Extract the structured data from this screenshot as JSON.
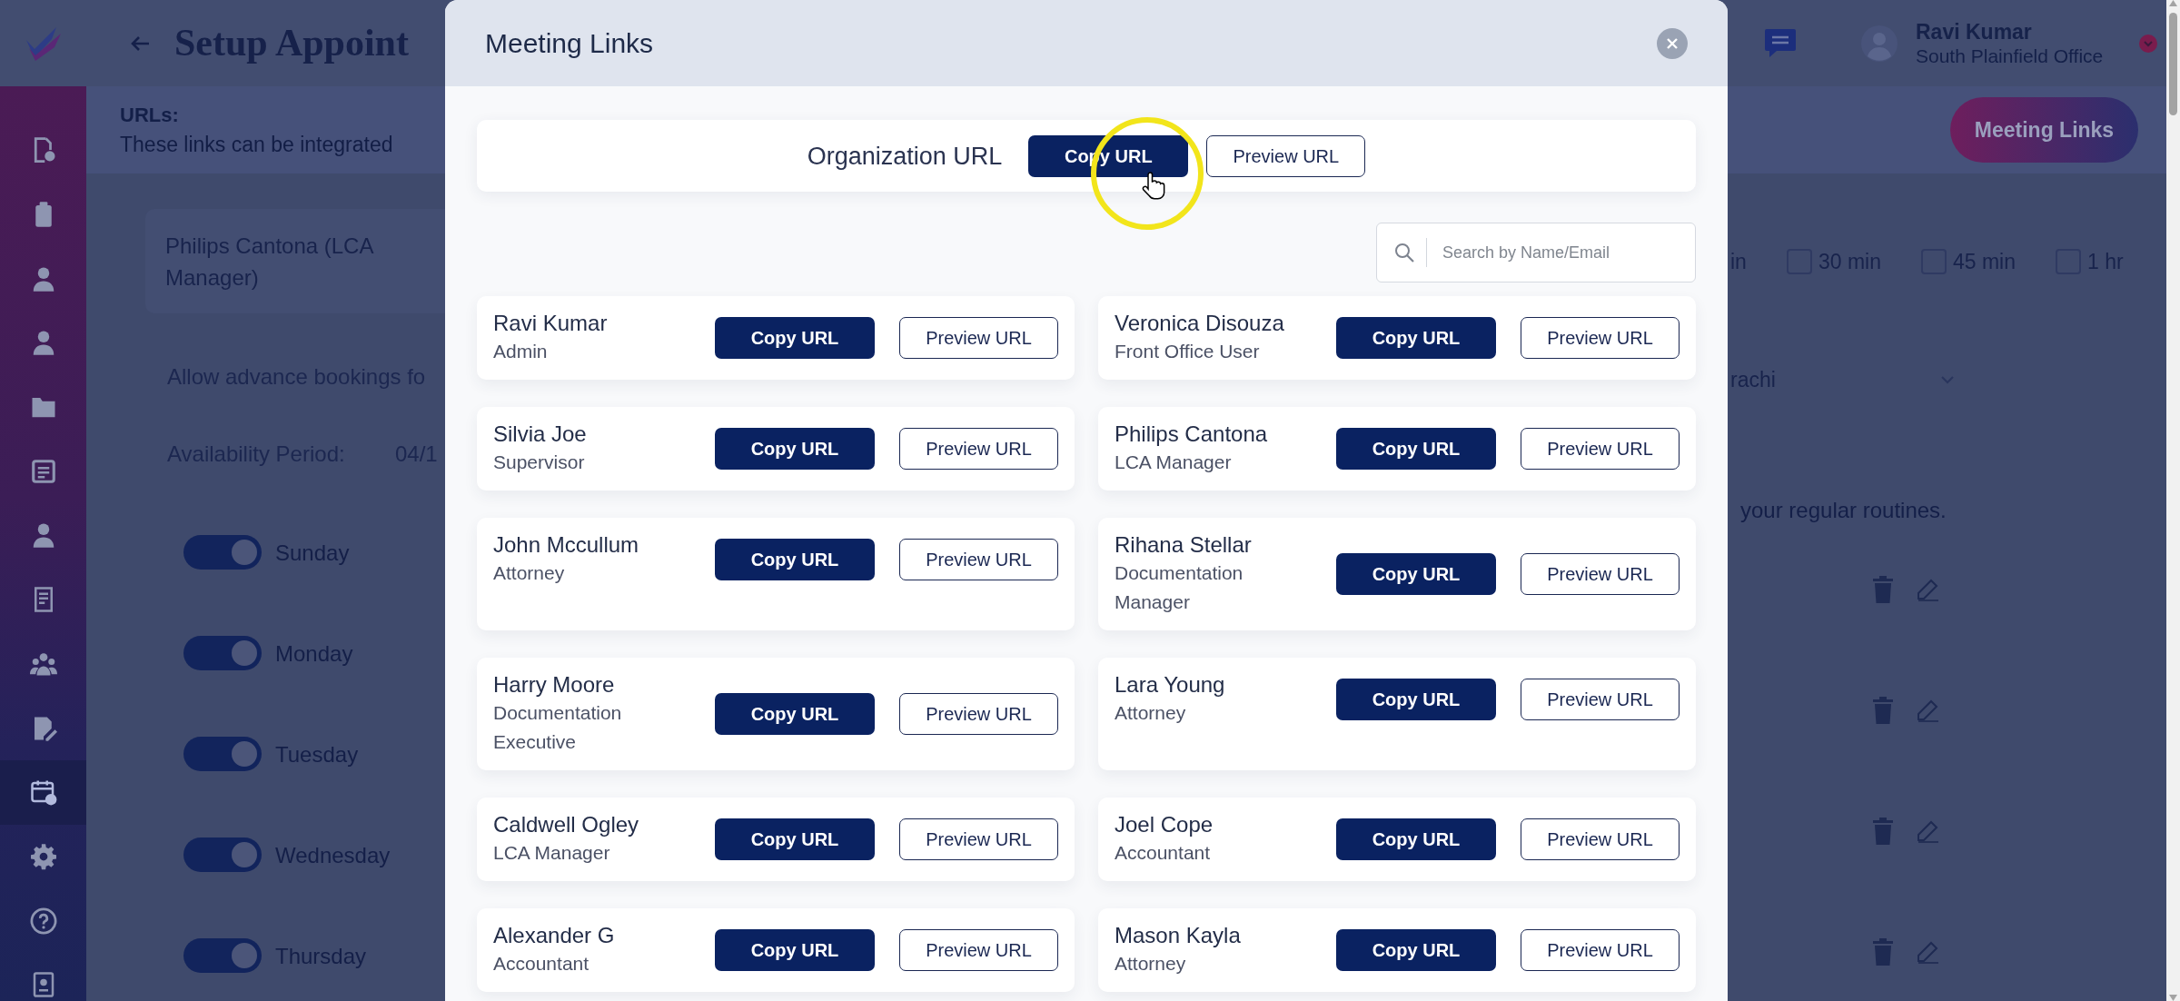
{
  "header": {
    "title": "Setup Appoint",
    "user": {
      "name": "Ravi Kumar",
      "office": "South Plainfield Office"
    }
  },
  "sidebar": {
    "items": [
      {
        "selected": false
      },
      {
        "selected": false
      },
      {
        "selected": false
      },
      {
        "selected": false
      },
      {
        "selected": false
      },
      {
        "selected": false
      },
      {
        "selected": false
      },
      {
        "selected": false
      },
      {
        "selected": false
      },
      {
        "selected": false
      },
      {
        "selected": true
      },
      {
        "selected": false
      },
      {
        "selected": false
      },
      {
        "selected": false
      }
    ]
  },
  "page": {
    "urls": {
      "title": "URLs:",
      "note": "These links can be integrated"
    },
    "meeting_links_button": "Meeting Links",
    "staff_select": "Philips Cantona (LCA Manager)",
    "advance_booking_label": "Allow advance bookings fo",
    "availability": {
      "label": "Availability Period:",
      "value": "04/1"
    },
    "days": [
      {
        "label": "Sunday",
        "on": true
      },
      {
        "label": "Monday",
        "on": true
      },
      {
        "label": "Tuesday",
        "on": true
      },
      {
        "label": "Wednesday",
        "on": true
      },
      {
        "label": "Thursday",
        "on": true
      }
    ],
    "duration_cut_label": "in",
    "durations": [
      {
        "label": "30 min",
        "checked": false
      },
      {
        "label": "45 min",
        "checked": false
      },
      {
        "label": "1 hr",
        "checked": false
      }
    ],
    "timezone_value": "rachi",
    "routines_note": "your regular routines."
  },
  "modal": {
    "title": "Meeting Links",
    "organization": {
      "label": "Organization URL",
      "copy_button": "Copy URL",
      "preview_button": "Preview URL"
    },
    "search": {
      "placeholder": "Search by Name/Email"
    },
    "members": [
      {
        "name": "Ravi Kumar",
        "role": "Admin",
        "copy_button": "Copy URL",
        "preview_button": "Preview URL"
      },
      {
        "name": "Veronica Disouza",
        "role": "Front Office User",
        "copy_button": "Copy URL",
        "preview_button": "Preview URL"
      },
      {
        "name": "Silvia Joe",
        "role": "Supervisor",
        "copy_button": "Copy URL",
        "preview_button": "Preview URL"
      },
      {
        "name": "Philips Cantona",
        "role": "LCA Manager",
        "copy_button": "Copy URL",
        "preview_button": "Preview URL"
      },
      {
        "name": "John Mccullum",
        "role": "Attorney",
        "copy_button": "Copy URL",
        "preview_button": "Preview URL"
      },
      {
        "name": "Rihana Stellar",
        "role": "Documentation Manager",
        "copy_button": "Copy URL",
        "preview_button": "Preview URL"
      },
      {
        "name": "Harry Moore",
        "role": "Documentation Executive",
        "copy_button": "Copy URL",
        "preview_button": "Preview URL"
      },
      {
        "name": "Lara Young",
        "role": "Attorney",
        "copy_button": "Copy URL",
        "preview_button": "Preview URL"
      },
      {
        "name": "Caldwell Ogley",
        "role": "LCA Manager",
        "copy_button": "Copy URL",
        "preview_button": "Preview URL"
      },
      {
        "name": "Joel Cope",
        "role": "Accountant",
        "copy_button": "Copy URL",
        "preview_button": "Preview URL"
      },
      {
        "name": "Alexander G",
        "role": "Accountant",
        "copy_button": "Copy URL",
        "preview_button": "Preview URL"
      },
      {
        "name": "Mason Kayla",
        "role": "Attorney",
        "copy_button": "Copy URL",
        "preview_button": "Preview URL"
      }
    ]
  }
}
